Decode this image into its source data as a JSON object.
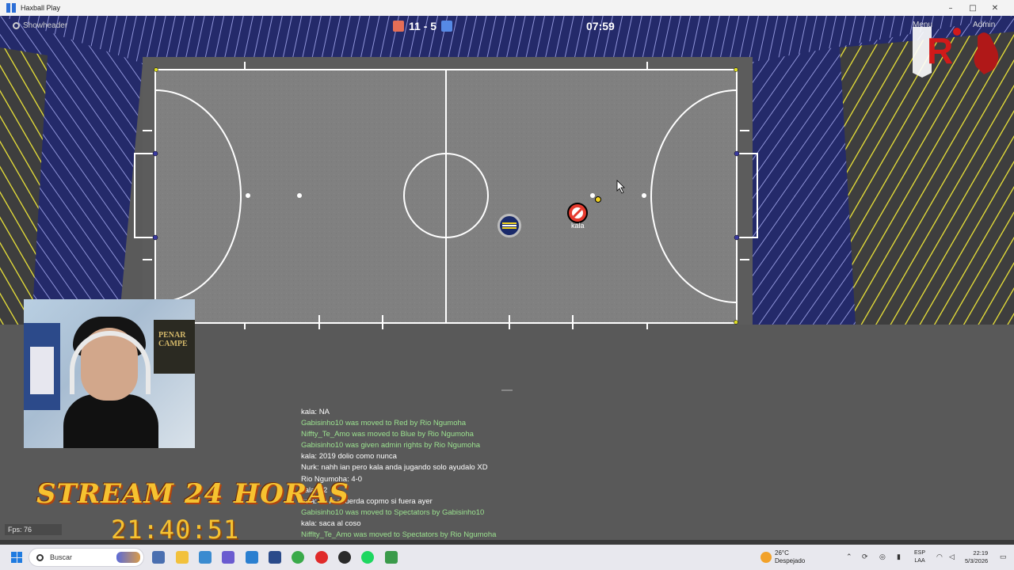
{
  "window": {
    "title": "Haxball Play",
    "minimize": "–",
    "maximize": "□",
    "close": "✕"
  },
  "hud": {
    "toggle_label": "Showheader",
    "score": "11 - 5",
    "timer": "07:59",
    "menu_label": "Menu",
    "admin_label": "Admin",
    "colors": {
      "red": "#e56e56",
      "blue": "#5689e5"
    }
  },
  "players": [
    {
      "name": "kala",
      "team": "red",
      "avatar": "no-entry-icon"
    },
    {
      "name": "",
      "team": "blue",
      "avatar": "stripes-icon"
    }
  ],
  "chat": {
    "messages": [
      {
        "text": "kala: NA",
        "type": "msg"
      },
      {
        "text": "Gabisinho10 was moved to Red by Rio Ngumoha",
        "type": "sys"
      },
      {
        "text": "Niffty_Te_Amo was moved to Blue by Rio Ngumoha",
        "type": "sys"
      },
      {
        "text": "Gabisinho10 was given admin rights by Rio Ngumoha",
        "type": "sys"
      },
      {
        "text": "kala: 2019 dolio como nunca",
        "type": "msg"
      },
      {
        "text": "Nurk: nahh ian pero kala anda jugando solo ayudalo XD",
        "type": "msg"
      },
      {
        "text": "Rio Ngumoha: 4-0",
        "type": "msg"
      },
      {
        "text": "kala: 72",
        "type": "msg"
      },
      {
        "text": "kala: se lo acuerda copmo si fuera ayer",
        "type": "msg"
      },
      {
        "text": "Gabisinho10 was moved to Spectators by Gabisinho10",
        "type": "sys"
      },
      {
        "text": "kala: saca al coso",
        "type": "msg"
      },
      {
        "text": "Nifflty_Te_Amo was moved to Spectators by Rio Ngumoha",
        "type": "sys"
      }
    ]
  },
  "fps": "Fps: 76",
  "overlay": {
    "stream_title": "STREAM 24 HORAS",
    "stream_clock": "21:40:51",
    "poster_text": "PENAR CAMPE"
  },
  "taskbar": {
    "search_label": "Buscar",
    "weather_temp": "26°C",
    "weather_desc": "Despejado",
    "lang_top": "ESP",
    "lang_bottom": "LAA",
    "time": "22:19",
    "date": "5/3/2026",
    "apps": [
      "store-icon",
      "folder-icon",
      "calculator-icon",
      "teams-icon",
      "notepad-icon",
      "capture-icon",
      "chrome-icon",
      "opera-icon",
      "obs-icon",
      "spotify-icon",
      "haxball-icon"
    ]
  }
}
